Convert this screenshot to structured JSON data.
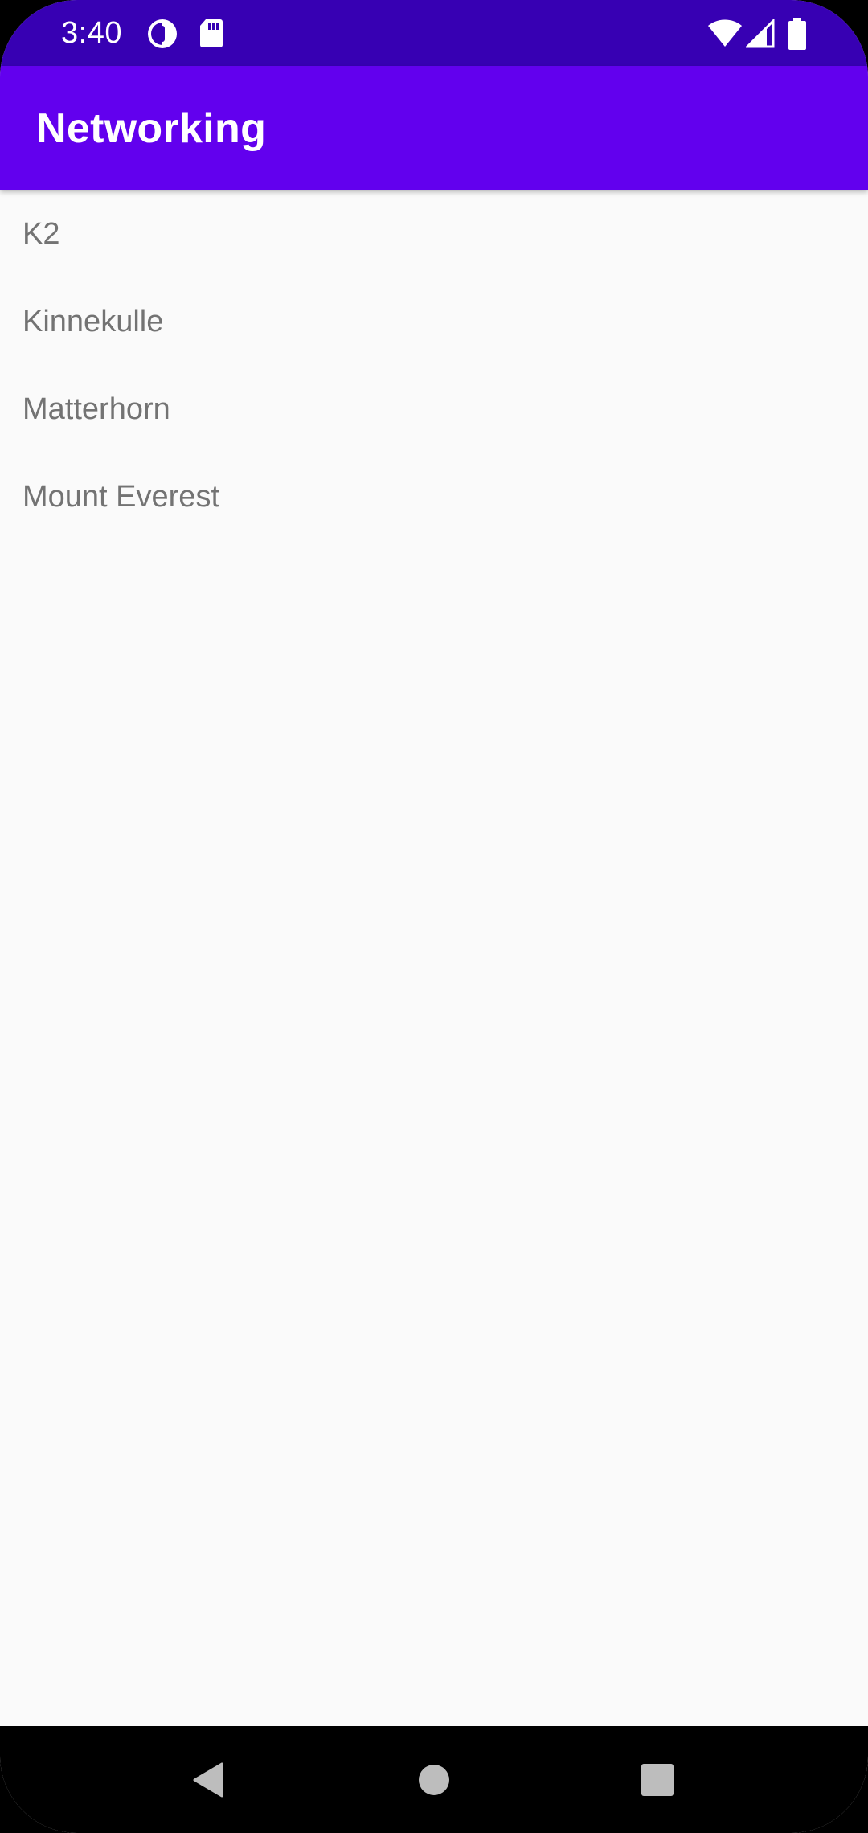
{
  "status_bar": {
    "time": "3:40",
    "left_icons": [
      "data-saver-icon",
      "sd-card-icon"
    ],
    "right_icons": [
      "wifi-icon",
      "cell-signal-icon",
      "battery-icon"
    ],
    "background": "#3700B3"
  },
  "app_bar": {
    "title": "Networking",
    "background": "#6200EE"
  },
  "list": {
    "items": [
      {
        "label": "K2"
      },
      {
        "label": "Kinnekulle"
      },
      {
        "label": "Matterhorn"
      },
      {
        "label": "Mount Everest"
      }
    ]
  },
  "nav_bar": {
    "buttons": [
      "back-icon",
      "home-icon",
      "recents-icon"
    ]
  },
  "colors": {
    "primary": "#6200EE",
    "primary_dark": "#3700B3",
    "background": "#FAFAFA",
    "list_text": "#737373"
  }
}
